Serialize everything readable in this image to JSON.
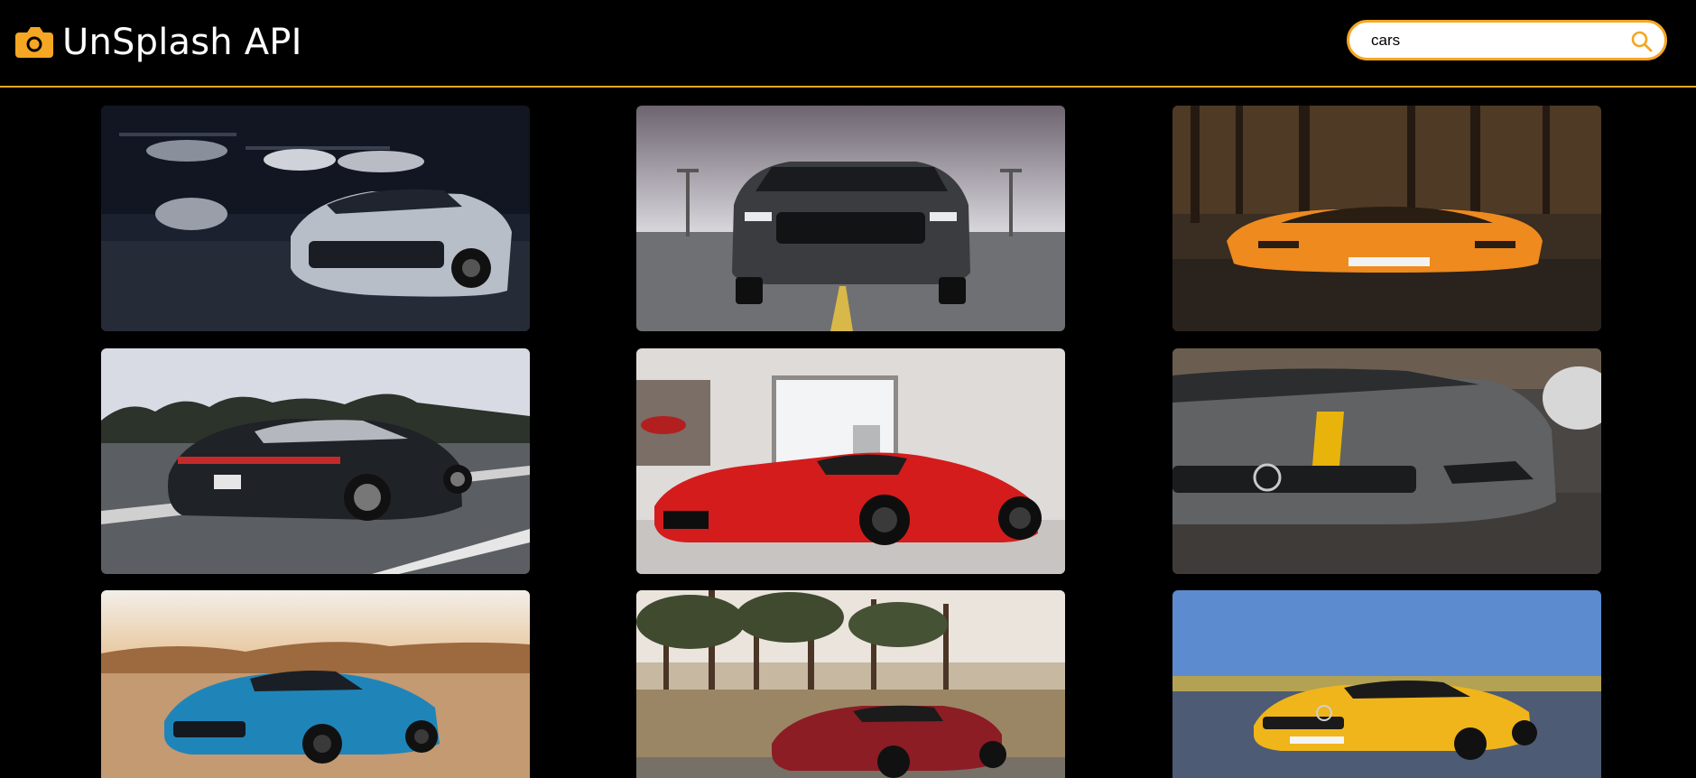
{
  "app": {
    "title": "UnSplash API",
    "brand_icon": "camera-icon",
    "accent_color": "#f5a623"
  },
  "search": {
    "value": "cars",
    "icon": "search-icon"
  }
}
